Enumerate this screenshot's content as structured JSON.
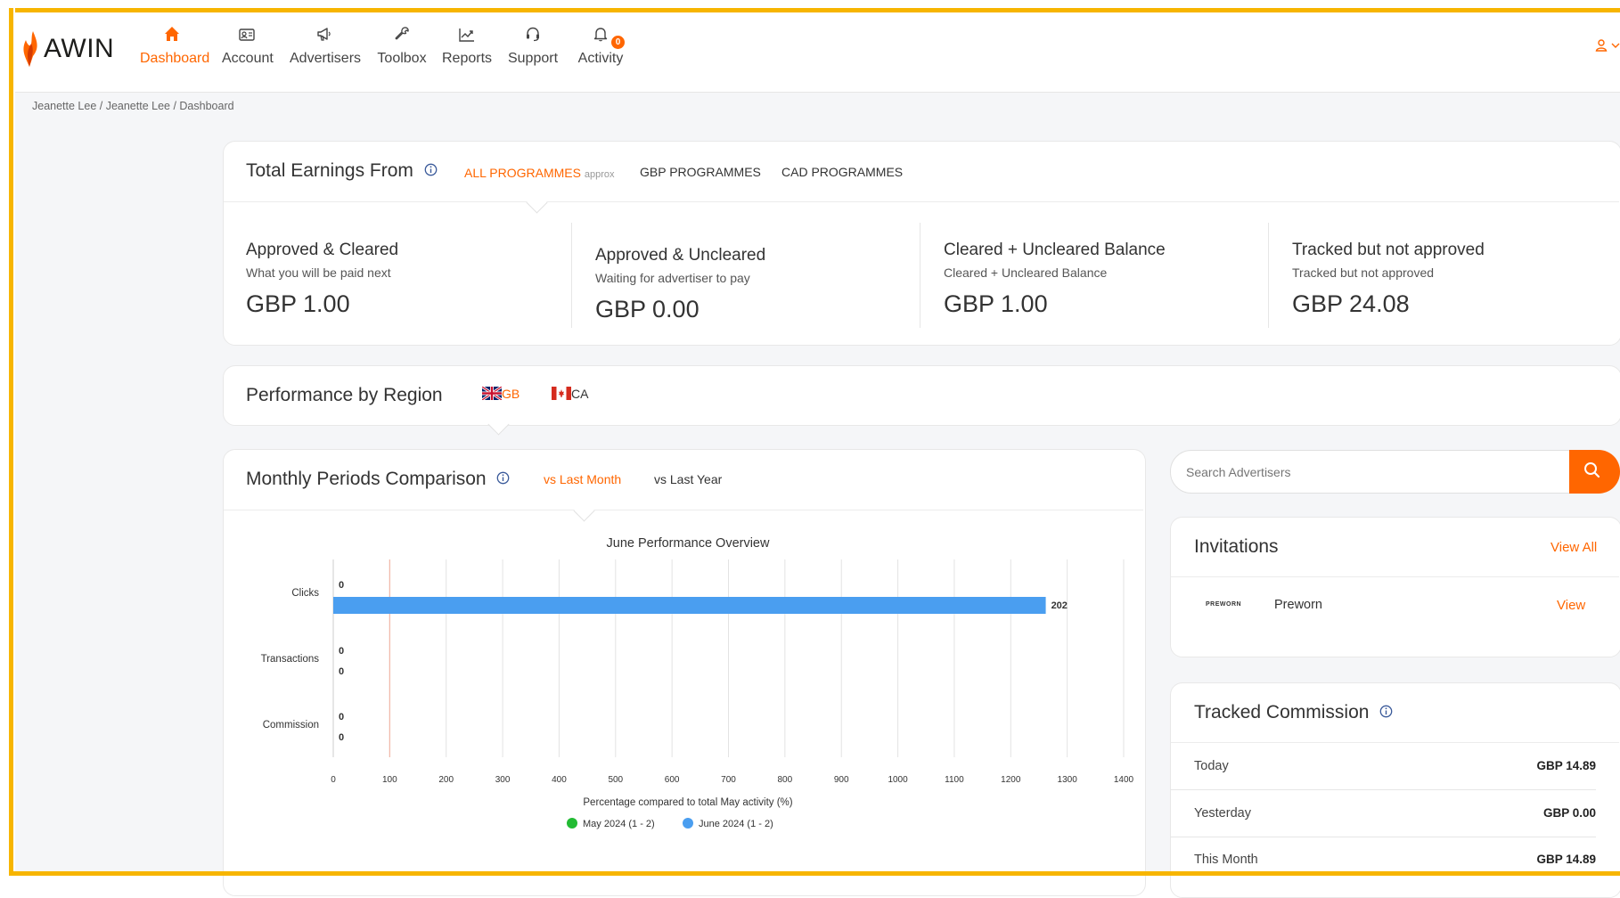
{
  "brand": {
    "name": "AWIN",
    "accent": "#ff6600",
    "frame_color": "#f7b500"
  },
  "nav": {
    "items": [
      {
        "label": "Dashboard",
        "icon": "home-icon",
        "active": true
      },
      {
        "label": "Account",
        "icon": "id-card-icon"
      },
      {
        "label": "Advertisers",
        "icon": "megaphone-icon"
      },
      {
        "label": "Toolbox",
        "icon": "wrench-icon"
      },
      {
        "label": "Reports",
        "icon": "chart-line-icon"
      },
      {
        "label": "Support",
        "icon": "headset-icon"
      },
      {
        "label": "Activity",
        "icon": "bell-icon",
        "badge": "0"
      }
    ]
  },
  "breadcrumb": "Jeanette Lee / Jeanette Lee / Dashboard",
  "earnings": {
    "title": "Total Earnings From",
    "tabs": [
      {
        "label": "ALL PROGRAMMES",
        "suffix": "approx",
        "active": true
      },
      {
        "label": "GBP PROGRAMMES"
      },
      {
        "label": "CAD PROGRAMMES"
      }
    ],
    "cols": [
      {
        "title": "Approved & Cleared",
        "sub": "What you will be paid next",
        "value": "GBP 1.00"
      },
      {
        "title": "Approved & Uncleared",
        "sub": "Waiting for advertiser to pay",
        "value": "GBP 0.00"
      },
      {
        "title": "Cleared + Uncleared Balance",
        "sub": "Cleared + Uncleared Balance",
        "value": "GBP 1.00"
      },
      {
        "title": "Tracked but not approved",
        "sub": "Tracked but not approved",
        "value": "GBP 24.08"
      }
    ]
  },
  "region": {
    "title": "Performance by Region",
    "gb": "GB",
    "ca": "CA"
  },
  "monthly": {
    "title": "Monthly Periods Comparison",
    "tab_active": "vs Last Month",
    "tab_other": "vs Last Year"
  },
  "chart_data": {
    "type": "bar",
    "orientation": "horizontal",
    "title": "June Performance Overview",
    "xlabel": "Percentage compared to total May activity (%)",
    "categories": [
      "Clicks",
      "Transactions",
      "Commission"
    ],
    "series": [
      {
        "name": "May 2024 (1 - 2)",
        "color": "#22bb33",
        "values": [
          0,
          0,
          0
        ],
        "labels": [
          "0",
          "0",
          "0"
        ]
      },
      {
        "name": "June 2024 (1 - 2)",
        "color": "#4a9ef0",
        "values": [
          1262,
          0,
          0
        ],
        "labels": [
          "202",
          "0",
          "0"
        ]
      }
    ],
    "xticks": [
      0,
      100,
      200,
      300,
      400,
      500,
      600,
      700,
      800,
      900,
      1000,
      1100,
      1200,
      1300,
      1400
    ],
    "xlim": [
      0,
      1400
    ],
    "reference_line": 100,
    "grid": true,
    "legend": "bottom"
  },
  "search": {
    "placeholder": "Search Advertisers"
  },
  "invitations": {
    "title": "Invitations",
    "view_all": "View All",
    "items": [
      {
        "logo_text": "PREWORN",
        "name": "Preworn",
        "action": "View"
      }
    ]
  },
  "tracked": {
    "title": "Tracked Commission",
    "rows": [
      {
        "label": "Today",
        "value": "GBP 14.89"
      },
      {
        "label": "Yesterday",
        "value": "GBP 0.00"
      },
      {
        "label": "This Month",
        "value": "GBP 14.89"
      }
    ]
  }
}
